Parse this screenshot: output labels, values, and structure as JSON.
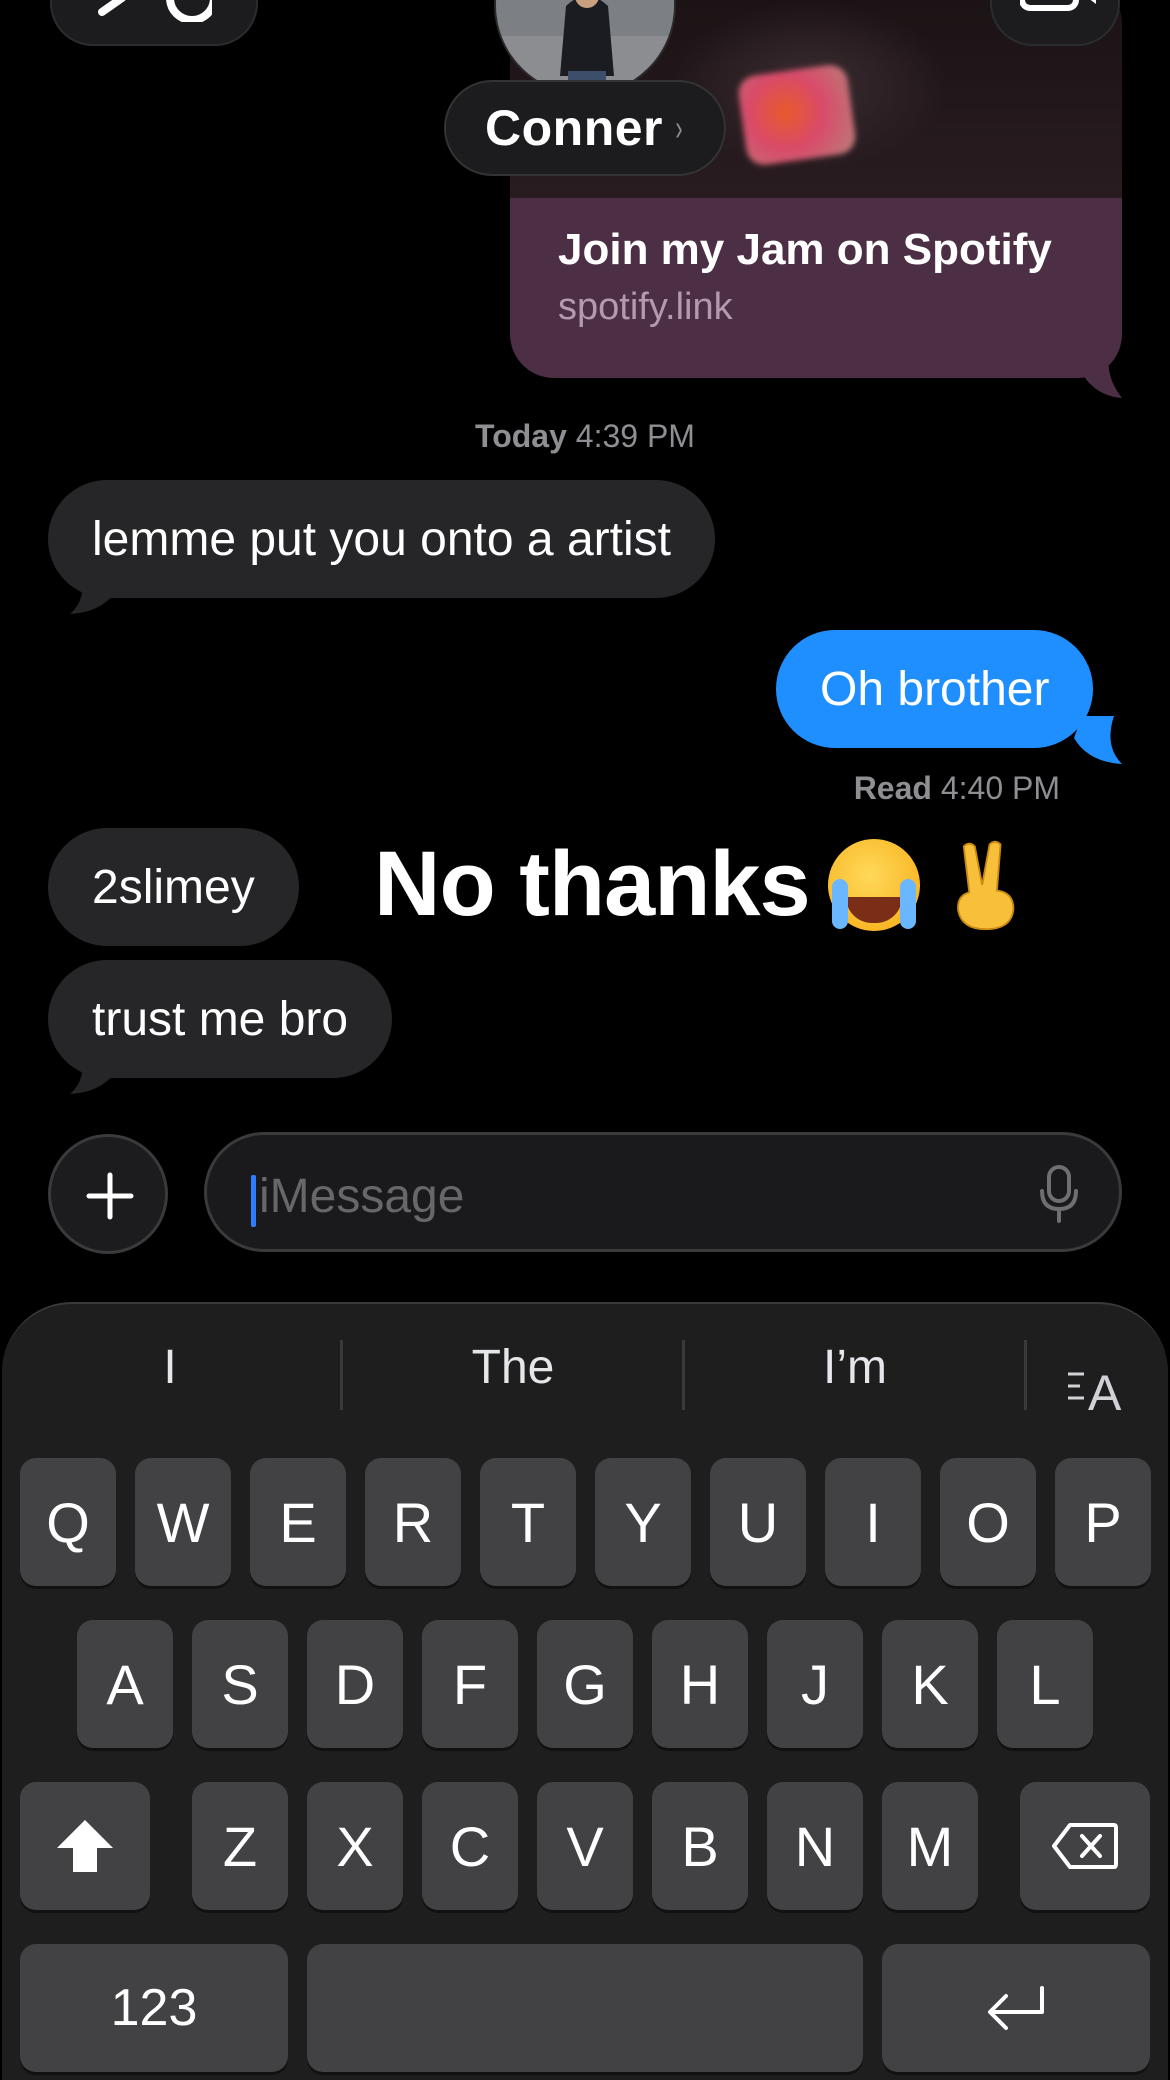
{
  "header": {
    "back_icon": "chevron-left-icon",
    "video_icon": "video-camera-icon",
    "contact_name": "Conner",
    "contact_chevron": "›"
  },
  "link_card": {
    "title": "Join my Jam on Spotify",
    "url": "spotify.link"
  },
  "timestamp": {
    "day": "Today",
    "time": "4:39 PM"
  },
  "messages": [
    {
      "from": "them",
      "text": "lemme put you onto a artist"
    },
    {
      "from": "me",
      "text": "Oh brother"
    },
    {
      "from": "them",
      "text": "2slimey"
    },
    {
      "from": "them",
      "text": "trust me bro"
    }
  ],
  "read_receipt": {
    "label": "Read",
    "time": "4:40 PM"
  },
  "overlay_text": "No thanks",
  "overlay_emojis": [
    "loudly-crying-face",
    "victory-hand"
  ],
  "compose": {
    "placeholder": "iMessage",
    "plus_icon": "plus-icon",
    "mic_icon": "microphone-icon"
  },
  "keyboard": {
    "predictions": [
      "I",
      "The",
      "I’m"
    ],
    "format_icon": "text-format-icon",
    "row1": [
      "Q",
      "W",
      "E",
      "R",
      "T",
      "Y",
      "U",
      "I",
      "O",
      "P"
    ],
    "row2": [
      "A",
      "S",
      "D",
      "F",
      "G",
      "H",
      "J",
      "K",
      "L"
    ],
    "row3": [
      "Z",
      "X",
      "C",
      "V",
      "B",
      "N",
      "M"
    ],
    "numbers_label": "123",
    "shift_icon": "shift-icon",
    "delete_icon": "delete-icon",
    "return_icon": "return-icon"
  },
  "colors": {
    "sent_bubble": "#1f8fff",
    "received_bubble": "#262628",
    "card_info": "#4c2f44",
    "background": "#000000"
  }
}
